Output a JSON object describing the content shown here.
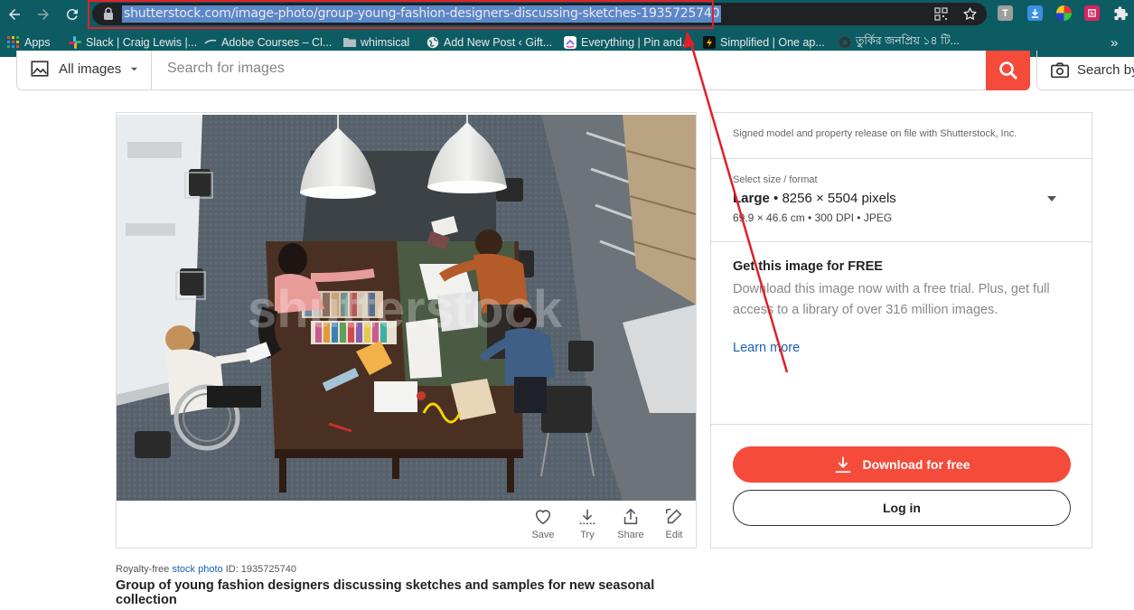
{
  "browser": {
    "url": "shutterstock.com/image-photo/group-young-fashion-designers-discussing-sketches-1935725740",
    "extensions": [
      {
        "icon": "translate-extension-icon",
        "label": "T",
        "color": "#9e9e9e"
      },
      {
        "icon": "download-extension-icon",
        "label": "",
        "color": "#3a8ee6"
      },
      {
        "icon": "color-wheel-extension-icon",
        "label": "",
        "color": "#c63cc8"
      },
      {
        "icon": "app-extension-icon",
        "label": "",
        "color": "#d7245f"
      },
      {
        "icon": "puzzle-extension-icon",
        "label": "",
        "color": "#e8eaed"
      }
    ],
    "bookmarks": [
      {
        "icon": "apps-grid-icon",
        "label": "Apps"
      },
      {
        "icon": "slack-icon",
        "label": "Slack | Craig Lewis |..."
      },
      {
        "icon": "adobe-courses-icon",
        "label": "Adobe Courses – Cl..."
      },
      {
        "icon": "folder-icon",
        "label": "whimsical"
      },
      {
        "icon": "globe-icon",
        "label": "Add New Post ‹ Gift..."
      },
      {
        "icon": "clickup-icon",
        "label": "Everything | Pin and..."
      },
      {
        "icon": "simplified-icon",
        "label": "Simplified | One ap..."
      },
      {
        "icon": "gear-site-icon",
        "label": "তুর্কির জনপ্রিয় ১৪ টি..."
      }
    ],
    "more_bookmarks": "»"
  },
  "search": {
    "filter_label": "All images",
    "placeholder": "Search for images",
    "search_by_label": "Search by"
  },
  "image_tools": [
    {
      "icon": "heart-icon",
      "label": "Save"
    },
    {
      "icon": "download-icon",
      "label": "Try"
    },
    {
      "icon": "share-icon",
      "label": "Share"
    },
    {
      "icon": "edit-icon",
      "label": "Edit"
    }
  ],
  "image_info": {
    "license_prefix": "Royalty-free",
    "license_link": "stock photo",
    "id_text": "ID: 1935725740",
    "title": "Group of young fashion designers discussing sketches and samples for new seasonal collection",
    "watermark": "shutterstock"
  },
  "panel": {
    "release_note": "Signed model and property release on file with Shutterstock, Inc.",
    "size_label": "Select size / format",
    "size_name": "Large",
    "size_pixels": "• 8256 × 5504 pixels",
    "size_details": "69.9 × 46.6 cm • 300 DPI • JPEG",
    "free_heading": "Get this image for FREE",
    "free_text": "Download this image now with a free trial. Plus, get full access to a library of over 316 million images.",
    "learn_more": "Learn more",
    "download_button": "Download for free",
    "login_button": "Log in"
  },
  "colors": {
    "accent": "#f44b3a",
    "chrome": "#0d5c63",
    "link": "#1a5fb4",
    "annotation": "#e0202a"
  }
}
